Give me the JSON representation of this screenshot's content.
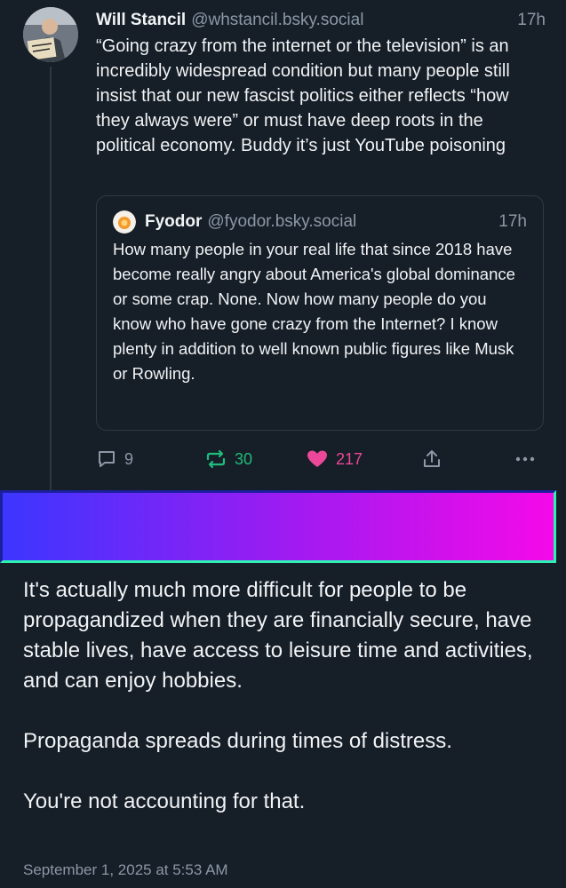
{
  "post": {
    "author_name": "Will Stancil",
    "author_handle": "@whstancil.bsky.social",
    "time": "17h",
    "avatar_sign_text": "Bring them BACK!",
    "text": "“Going crazy from the internet or the television” is an incredibly widespread condition but many people still insist that our new fascist politics either reflects “how they always were” or must have deep roots in the political economy. Buddy it’s just YouTube poisoning"
  },
  "quote": {
    "author_name": "Fyodor",
    "author_handle": "@fyodor.bsky.social",
    "time": "17h",
    "text": "How many people in your real life that since 2018 have become really angry about America's global dominance or some crap. None. Now how many people do you know who have gone crazy from the Internet? I know plenty in addition to well known public figures like Musk or Rowling."
  },
  "actions": {
    "reply_count": "9",
    "repost_count": "30",
    "like_count": "217",
    "icons": [
      "reply-icon",
      "repost-icon",
      "heart-icon",
      "share-icon",
      "more-icon"
    ]
  },
  "colors": {
    "background": "#161e27",
    "muted": "#8c98a7",
    "repost": "#20bc7c",
    "like": "#ec4899",
    "banner_start": "#3b36ff",
    "banner_end": "#f509e8"
  },
  "reply": {
    "paragraphs": [
      "It's actually much more difficult for people to be propagandized when they are financially secure, have stable lives, have access to leisure time and activities,  and can enjoy hobbies.",
      "Propaganda spreads during times of distress.",
      "You're not accounting for that."
    ],
    "timestamp": "September 1, 2025 at 5:53 AM"
  }
}
